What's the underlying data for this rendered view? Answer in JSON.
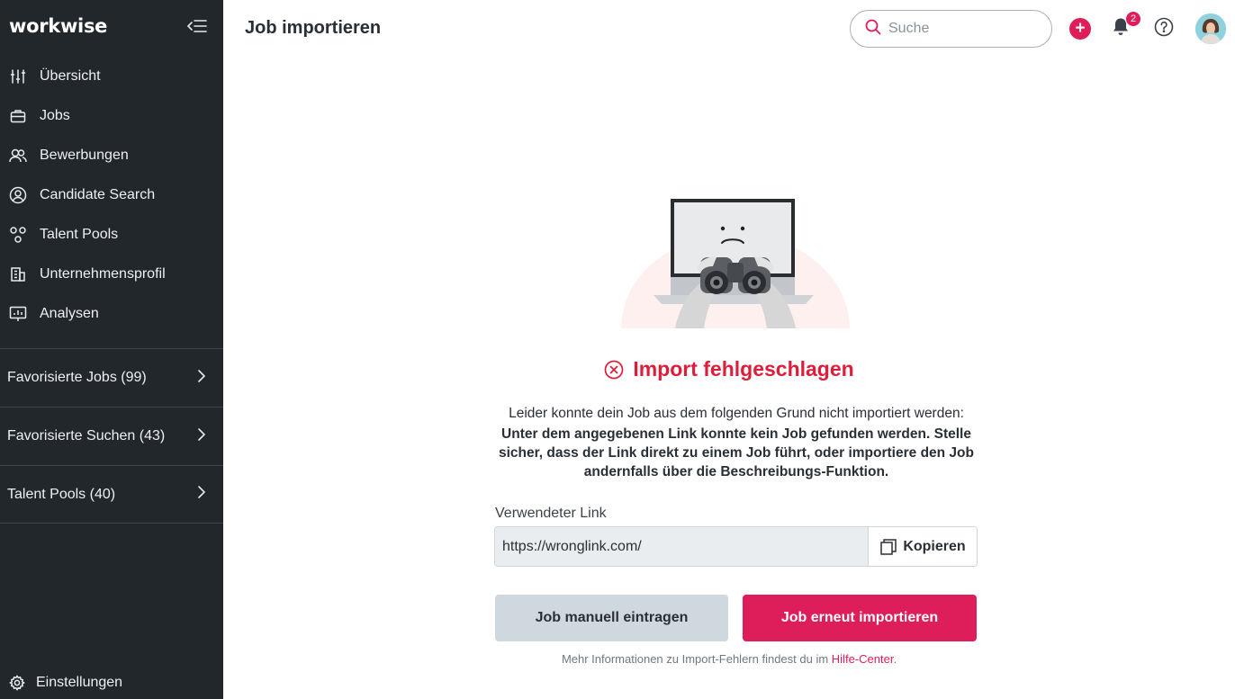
{
  "brand": {
    "logo_text": "workwise",
    "accent": "#dd1e5a",
    "error": "#dd1e3a",
    "sidebar_bg": "#22272c"
  },
  "sidebar": {
    "collapse_icon": "collapse-menu-icon",
    "items": [
      {
        "label": "Übersicht",
        "icon": "sliders-icon"
      },
      {
        "label": "Jobs",
        "icon": "briefcase-icon"
      },
      {
        "label": "Bewerbungen",
        "icon": "people-icon"
      },
      {
        "label": "Candidate Search",
        "icon": "user-circle-icon"
      },
      {
        "label": "Talent Pools",
        "icon": "pool-icon"
      },
      {
        "label": "Unternehmensprofil",
        "icon": "building-icon"
      },
      {
        "label": "Analysen",
        "icon": "chart-board-icon"
      }
    ],
    "favorites": [
      {
        "label": "Favorisierte Jobs (99)"
      },
      {
        "label": "Favorisierte Suchen (43)"
      },
      {
        "label": "Talent Pools (40)"
      }
    ],
    "settings": {
      "label": "Einstellungen",
      "icon": "gear-icon"
    }
  },
  "header": {
    "title": "Job importieren",
    "search_placeholder": "Suche",
    "notifications_count": "2"
  },
  "main": {
    "error_title": "Import fehlgeschlagen",
    "reason_intro": "Leider konnte dein Job aus dem folgenden Grund nicht importiert werden:",
    "reason_detail": "Unter dem angegebenen Link konnte kein Job gefunden werden. Stelle sicher, dass der Link direkt zu einem Job führt, oder importiere den Job andernfalls über die Beschreibungs-Funktion.",
    "link_label": "Verwendeter Link",
    "link_value": "https://wronglink.com/",
    "copy_label": "Kopieren",
    "manual_button": "Job manuell eintragen",
    "retry_button": "Job erneut importieren",
    "footnote_text": "Mehr Informationen zu Import-Fehlern findest du im ",
    "footnote_link": "Hilfe-Center",
    "footnote_end": "."
  }
}
